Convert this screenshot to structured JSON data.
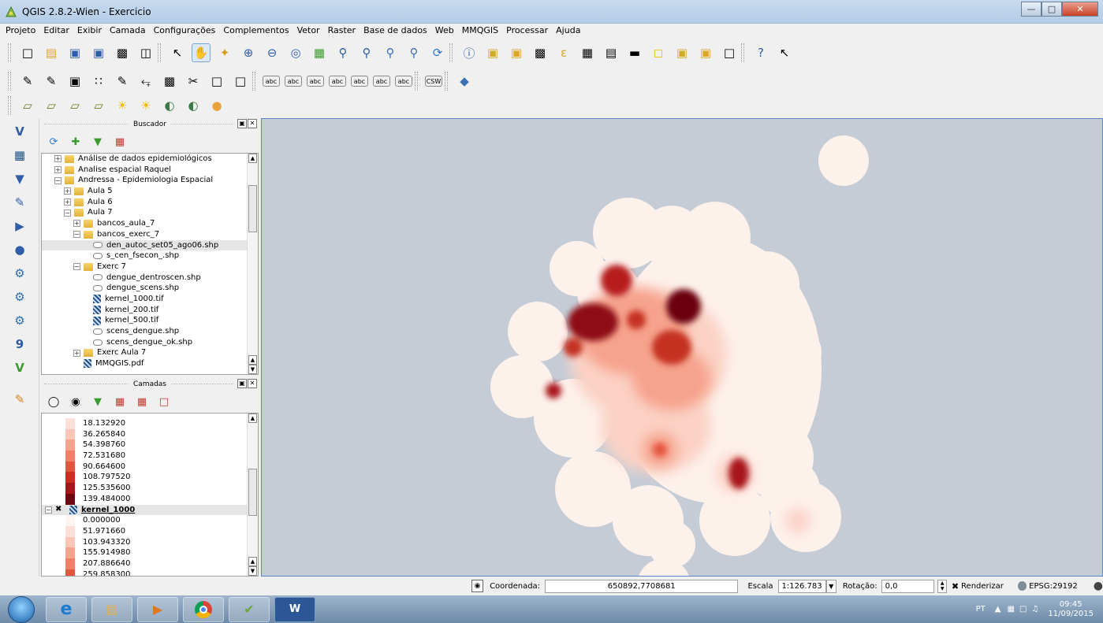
{
  "window": {
    "title": "QGIS 2.8.2-Wien - Exercicio"
  },
  "menu": [
    "Projeto",
    "Editar",
    "Exibir",
    "Camada",
    "Configurações",
    "Complementos",
    "Vetor",
    "Raster",
    "Base de dados",
    "Web",
    "MMQGIS",
    "Processar",
    "Ajuda"
  ],
  "toolbars": {
    "main": [
      "new-project-icon",
      "open-project-icon",
      "save-project-icon",
      "save-as-icon",
      "print-composer-icon",
      "composer-manager-icon",
      "touch-zoom-icon",
      "pan-icon",
      "pan-to-selection-icon",
      "zoom-in-icon",
      "zoom-out-icon",
      "zoom-native-icon",
      "zoom-full-icon",
      "zoom-to-selection-icon",
      "zoom-to-layer-icon",
      "zoom-last-icon",
      "zoom-next-icon",
      "refresh-icon",
      "identify-icon",
      "select-icon",
      "deselect-icon",
      "field-calculator-icon",
      "expression-icon",
      "attribute-table-icon",
      "statistics-icon",
      "measure-icon",
      "tip-icon",
      "new-bookmark-icon",
      "show-bookmarks-icon",
      "text-annotation-icon",
      "help-icon",
      "whats-this-icon"
    ],
    "digitizing": [
      "current-edits-icon",
      "toggle-editing-icon",
      "save-edits-icon",
      "add-feature-icon",
      "node-tool-icon",
      "move-feature-icon",
      "delete-selected-icon",
      "cut-features-icon",
      "copy-features-icon",
      "paste-features-icon",
      "label-icon",
      "label-pin-icon",
      "label-show-icon",
      "label-move-icon",
      "label-rotate-icon",
      "label-change-icon",
      "label-highlight-icon",
      "csw-icon",
      "python-icon"
    ],
    "raster": [
      "histogram-stretch-full-icon",
      "histogram-stretch-local-icon",
      "cumulative-cut-full-icon",
      "cumulative-cut-local-icon",
      "increase-brightness-icon",
      "decrease-brightness-icon",
      "increase-contrast-icon",
      "decrease-contrast-icon",
      "georeferencer-icon"
    ]
  },
  "left_tools": [
    "add-vector-layer-icon",
    "add-raster-layer-icon",
    "add-postgis-icon",
    "add-spatialite-icon",
    "add-mssql-icon",
    "add-oracle-icon",
    "add-wms-icon",
    "add-wcs-icon",
    "add-wfs-icon",
    "add-delimited-text-icon",
    "new-shapefile-icon",
    "digitize-icon"
  ],
  "browser": {
    "title": "Buscador",
    "items": [
      {
        "indent": 1,
        "exp": "+",
        "icon": "folder",
        "label": "Análise de dados epidemiológicos"
      },
      {
        "indent": 1,
        "exp": "+",
        "icon": "folder",
        "label": "Analise espacial Raquel"
      },
      {
        "indent": 1,
        "exp": "-",
        "icon": "folder",
        "label": "Andressa - Epidemiologia Espacial"
      },
      {
        "indent": 2,
        "exp": "+",
        "icon": "folder",
        "label": "Aula 5"
      },
      {
        "indent": 2,
        "exp": "+",
        "icon": "folder",
        "label": "Aula 6"
      },
      {
        "indent": 2,
        "exp": "-",
        "icon": "folder",
        "label": "Aula 7"
      },
      {
        "indent": 3,
        "exp": "+",
        "icon": "folder",
        "label": "bancos_aula_7"
      },
      {
        "indent": 3,
        "exp": "-",
        "icon": "folder",
        "label": "bancos_exerc_7"
      },
      {
        "indent": 4,
        "exp": "",
        "icon": "shp",
        "label": "den_autoc_set05_ago06.shp",
        "selected": true
      },
      {
        "indent": 4,
        "exp": "",
        "icon": "shp",
        "label": "s_cen_fsecon_.shp"
      },
      {
        "indent": 3,
        "exp": "-",
        "icon": "folder",
        "label": "Exerc 7"
      },
      {
        "indent": 4,
        "exp": "",
        "icon": "shp",
        "label": "dengue_dentroscen.shp"
      },
      {
        "indent": 4,
        "exp": "",
        "icon": "shp",
        "label": "dengue_scens.shp"
      },
      {
        "indent": 4,
        "exp": "",
        "icon": "ras",
        "label": "kernel_1000.tif"
      },
      {
        "indent": 4,
        "exp": "",
        "icon": "ras",
        "label": "kernel_200.tif"
      },
      {
        "indent": 4,
        "exp": "",
        "icon": "ras",
        "label": "kernel_500.tif"
      },
      {
        "indent": 4,
        "exp": "",
        "icon": "shp",
        "label": "scens_dengue.shp"
      },
      {
        "indent": 4,
        "exp": "",
        "icon": "shp",
        "label": "scens_dengue_ok.shp"
      },
      {
        "indent": 3,
        "exp": "+",
        "icon": "folder",
        "label": "Exerc Aula 7"
      },
      {
        "indent": 3,
        "exp": "",
        "icon": "ras",
        "label": "MMQGIS.pdf"
      }
    ]
  },
  "layers": {
    "title": "Camadas",
    "legend_top": [
      {
        "value": "18.132920",
        "color": "#fde0d9"
      },
      {
        "value": "36.265840",
        "color": "#fcc5b6"
      },
      {
        "value": "54.398760",
        "color": "#f9a38f"
      },
      {
        "value": "72.531680",
        "color": "#f37f69"
      },
      {
        "value": "90.664600",
        "color": "#e65440"
      },
      {
        "value": "108.797520",
        "color": "#cf2b22"
      },
      {
        "value": "125.535600",
        "color": "#a8141a"
      },
      {
        "value": "139.484000",
        "color": "#6e0710"
      }
    ],
    "layer_name": "kernel_1000",
    "legend_bottom": [
      {
        "value": "0.000000",
        "color": "#fff5f0"
      },
      {
        "value": "51.971660",
        "color": "#fde0d9"
      },
      {
        "value": "103.943320",
        "color": "#fcc5b6"
      },
      {
        "value": "155.914980",
        "color": "#f9a38f"
      },
      {
        "value": "207.886640",
        "color": "#f37f69"
      },
      {
        "value": "259.858300",
        "color": "#e65440"
      }
    ]
  },
  "status": {
    "coord_label": "Coordenada:",
    "coord_value": "650892,7708681",
    "scale_label": "Escala",
    "scale_value": "1:126.783",
    "rotation_label": "Rotação:",
    "rotation_value": "0,0",
    "render_label": "Renderizar",
    "crs": "EPSG:29192"
  },
  "taskbar": {
    "lang": "PT",
    "time": "09:45",
    "date": "11/09/2015"
  }
}
